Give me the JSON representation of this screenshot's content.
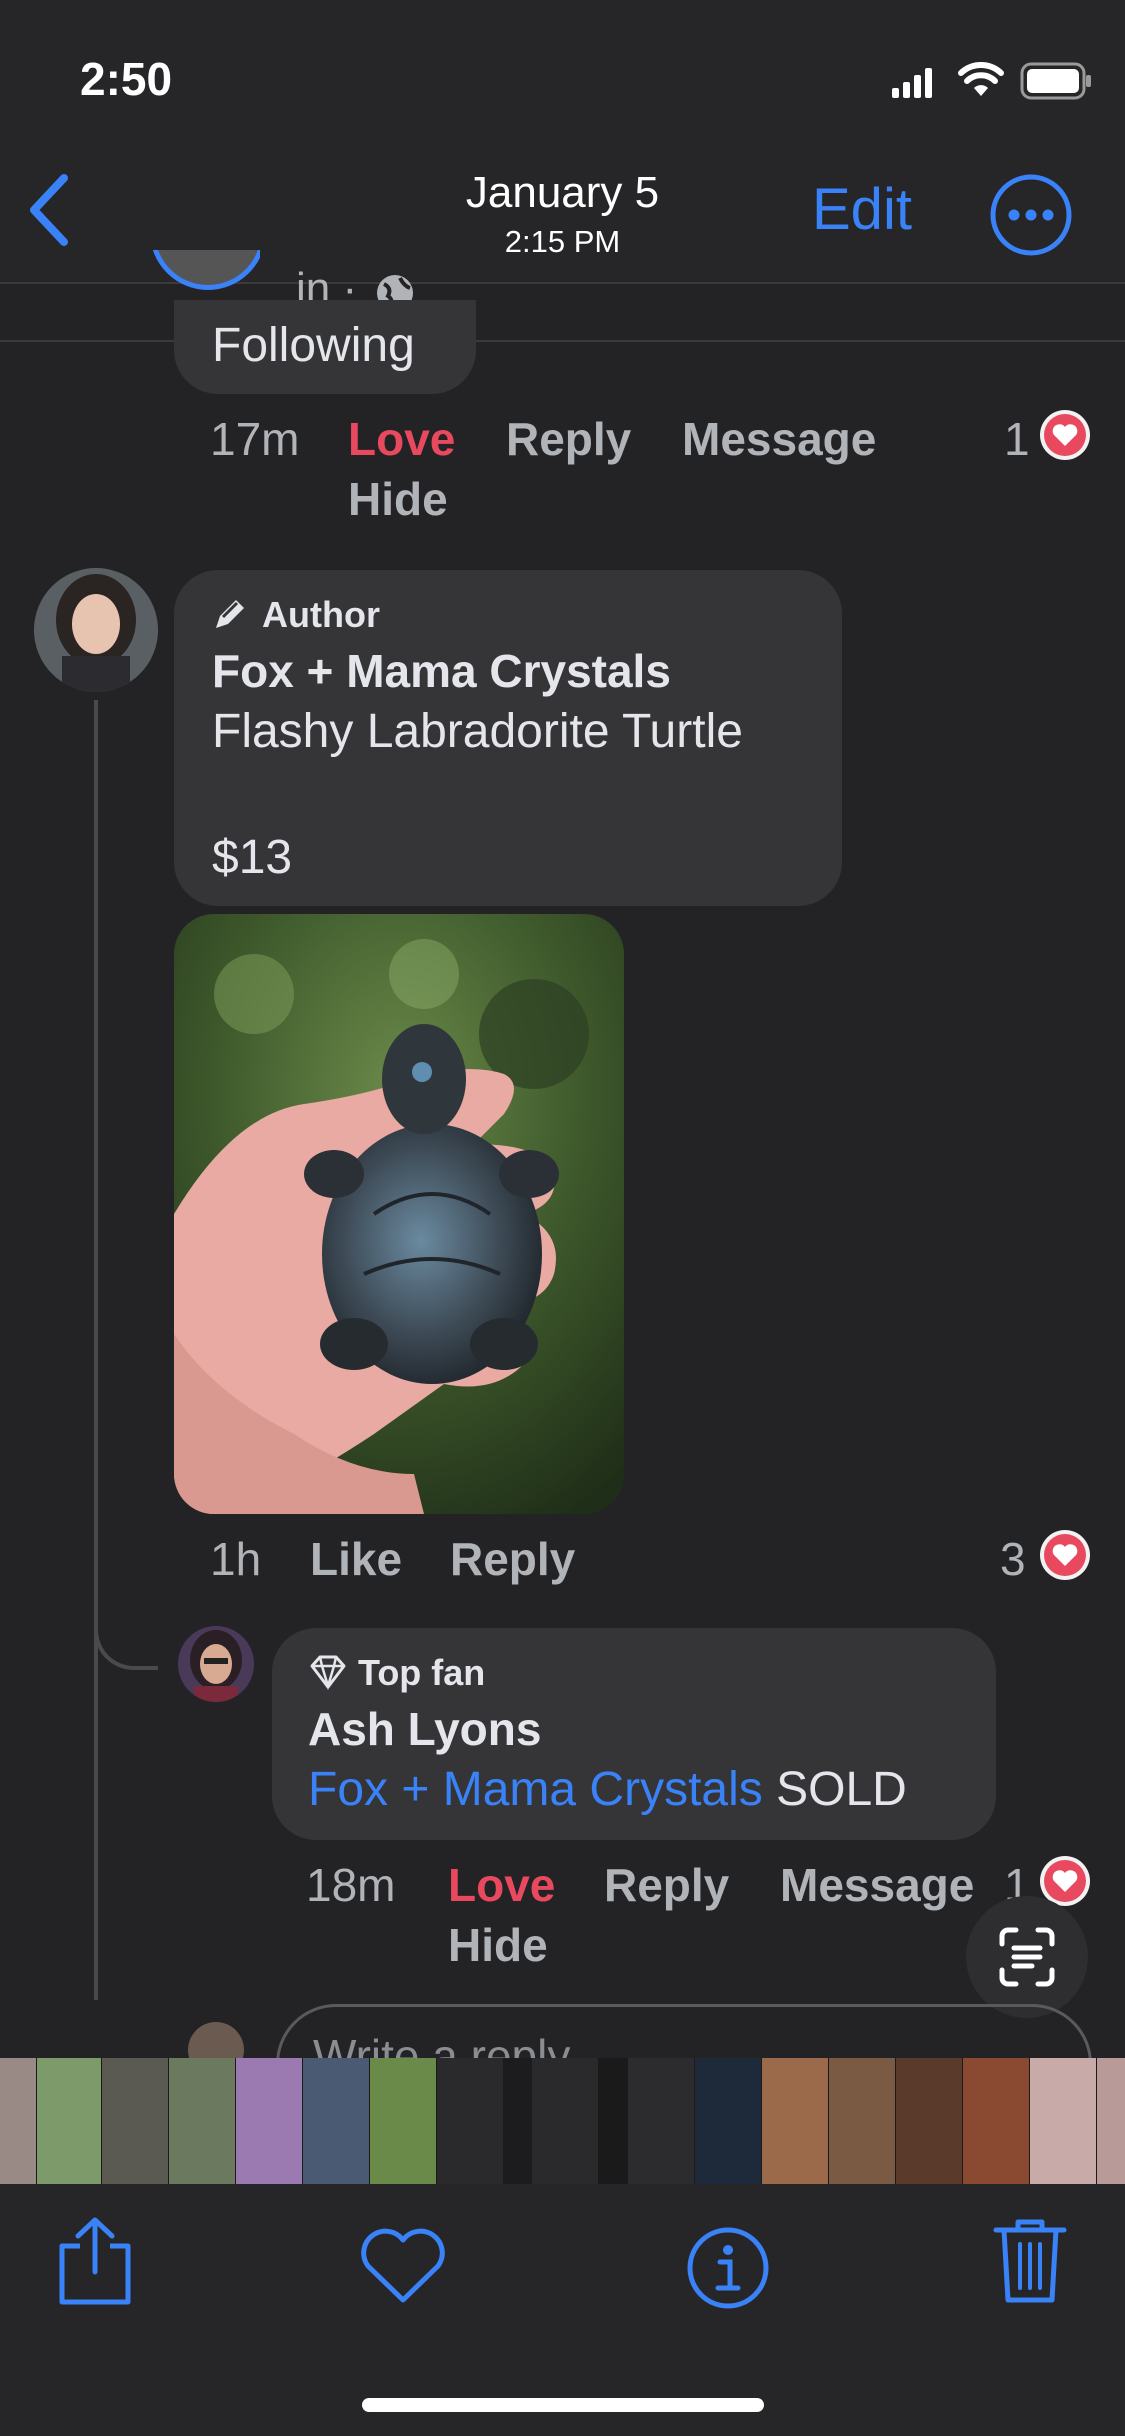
{
  "status_bar": {
    "time": "2:50"
  },
  "nav": {
    "title": "January 5",
    "subtitle": "2:15 PM",
    "edit_label": "Edit"
  },
  "prev_comment": {
    "meta_partial": "in ·",
    "bubble_partial_text": "Following",
    "time": "17m",
    "love_label": "Love",
    "reply_label": "Reply",
    "message_label": "Message",
    "hide_label": "Hide",
    "reaction_count": "1"
  },
  "author_comment": {
    "badge_label": "Author",
    "name": "Fox + Mama Crystals",
    "line1": "Flashy Labradorite Turtle",
    "line2": "$13",
    "time": "1h",
    "like_label": "Like",
    "reply_label": "Reply",
    "reaction_count": "3"
  },
  "reply_comment": {
    "badge_label": "Top fan",
    "name": "Ash Lyons",
    "mention": "Fox + Mama Crystals",
    "text": " SOLD",
    "time": "18m",
    "love_label": "Love",
    "reply_label": "Reply",
    "message_label": "Message",
    "hide_label": "Hide",
    "reaction_count": "1"
  },
  "composer": {
    "placeholder": "Write a reply..."
  },
  "toolbar": {
    "share_icon": "share-icon",
    "favorite_icon": "heart-icon",
    "info_icon": "info-icon",
    "delete_icon": "trash-icon"
  },
  "colors": {
    "accent": "#3a82f7",
    "love": "#e9495f",
    "background": "#232325",
    "bubble": "#353538"
  }
}
